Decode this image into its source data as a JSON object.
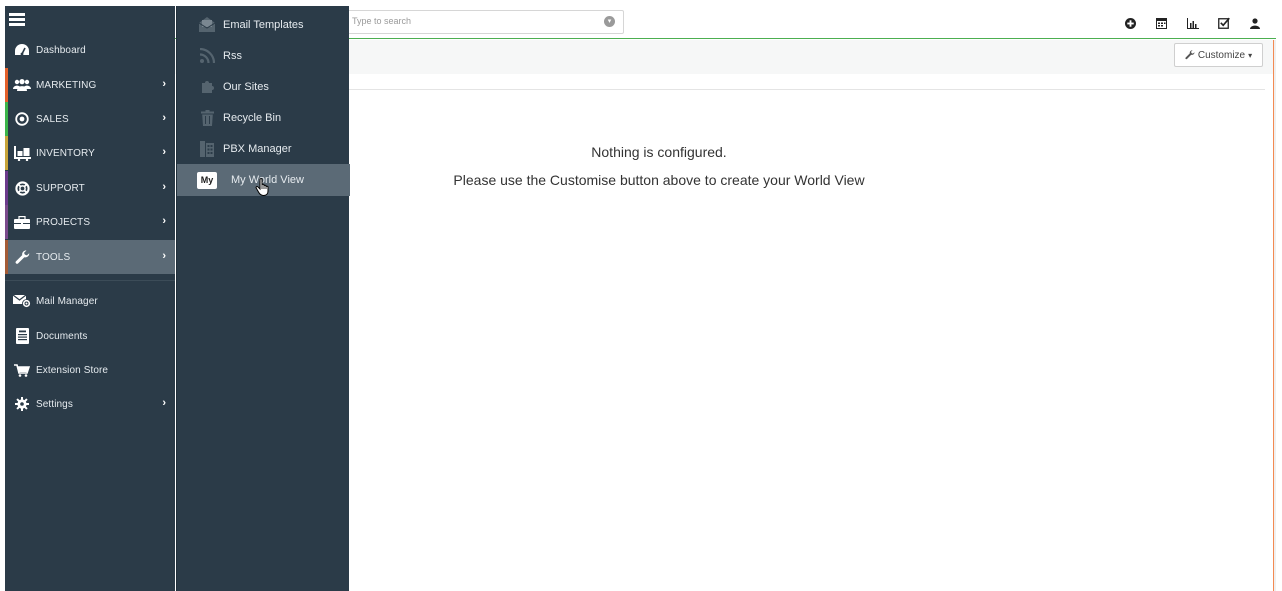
{
  "search": {
    "placeholder": "Type to search"
  },
  "top_icons": [
    "plus-circle-icon",
    "calendar-icon",
    "chart-icon",
    "checkbox-icon",
    "user-icon"
  ],
  "subheader": {
    "customize_label": "Customize"
  },
  "main": {
    "empty_line1": "Nothing is configured.",
    "empty_line2": "Please use the Customise button above to create your World View"
  },
  "sidebar": {
    "items": [
      {
        "label": "Dashboard",
        "icon": "dashboard-icon",
        "has_arrow": false
      },
      {
        "label": "MARKETING",
        "icon": "users-icon",
        "has_arrow": true,
        "accent": "#e3602b"
      },
      {
        "label": "SALES",
        "icon": "target-icon",
        "has_arrow": true,
        "accent": "#3bb44a"
      },
      {
        "label": "INVENTORY",
        "icon": "dolly-icon",
        "has_arrow": true,
        "accent": "#c7a43a"
      },
      {
        "label": "SUPPORT",
        "icon": "lifebuoy-icon",
        "has_arrow": true,
        "accent": "#6b3a8c"
      },
      {
        "label": "PROJECTS",
        "icon": "briefcase-icon",
        "has_arrow": true,
        "accent": "#7a4a8c"
      },
      {
        "label": "TOOLS",
        "icon": "wrench-icon",
        "has_arrow": true,
        "accent": "#a35b36"
      },
      {
        "label": "Mail Manager",
        "icon": "mail-manager-icon",
        "has_arrow": false
      },
      {
        "label": "Documents",
        "icon": "document-icon",
        "has_arrow": false
      },
      {
        "label": "Extension Store",
        "icon": "cart-icon",
        "has_arrow": false
      },
      {
        "label": "Settings",
        "icon": "gear-icon",
        "has_arrow": true
      }
    ]
  },
  "flyout": {
    "items": [
      {
        "label": "Email Templates",
        "icon": "email-template-icon"
      },
      {
        "label": "Rss",
        "icon": "rss-icon"
      },
      {
        "label": "Our Sites",
        "icon": "puzzle-icon"
      },
      {
        "label": "Recycle Bin",
        "icon": "trash-icon"
      },
      {
        "label": "PBX Manager",
        "icon": "pbx-icon"
      },
      {
        "label": "My World View",
        "icon": "my-badge-icon",
        "badge": "My"
      }
    ]
  },
  "colors": {
    "sidebar_bg": "#2b3b48",
    "active_bg": "#5b6a76",
    "topbar_accent": "#4caf50"
  }
}
